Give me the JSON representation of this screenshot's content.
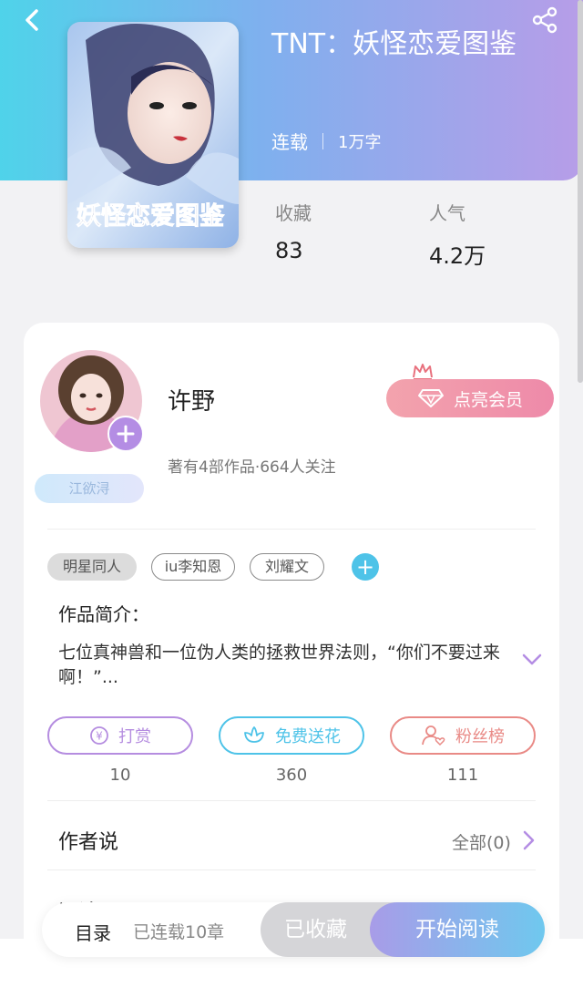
{
  "header": {
    "book_title": "TNT：妖怪恋爱图鉴",
    "status": "连载",
    "word_count": "1万字",
    "cover_lettering": "妖怪恋爱图鉴",
    "colors": {
      "gradient_start": "#4fd3ea",
      "gradient_end": "#b79de8"
    }
  },
  "stats": {
    "favorites_label": "收藏",
    "favorites_value": "83",
    "popularity_label": "人气",
    "popularity_value": "4.2万"
  },
  "author": {
    "name": "许野",
    "info": "著有4部作品·664人关注",
    "fan_badge": "江欲浔",
    "vip_button": "点亮会员",
    "follow_icon": "plus-icon"
  },
  "tags": {
    "items": [
      "明星同人",
      "iu李知恩",
      "刘耀文"
    ]
  },
  "intro": {
    "title": "作品简介：",
    "text": "七位真神兽和一位伪人类的拯救世界法则，“你们不要过来啊！”..."
  },
  "actions": {
    "tip_label": "打赏",
    "tip_count": "10",
    "flower_label": "免费送花",
    "flower_count": "360",
    "fans_label": "粉丝榜",
    "fans_count": "111",
    "colors": {
      "tip": "#b58de0",
      "flower": "#4ec3e8",
      "fans": "#e98a86"
    }
  },
  "author_say": {
    "title": "作者说",
    "all_label": "全部(0)"
  },
  "comments": {
    "title": "评论"
  },
  "bottom_bar": {
    "toc_label": "目录",
    "toc_status": "已连载10章",
    "collected_label": "已收藏",
    "start_label": "开始阅读"
  }
}
